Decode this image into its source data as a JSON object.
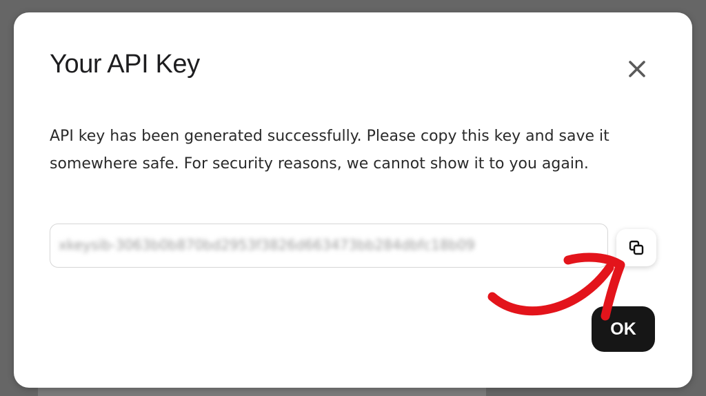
{
  "dialog": {
    "title": "Your API Key",
    "message": "API key has been generated successfully. Please copy this key and save it somewhere safe. For security reasons, we cannot show it to you again.",
    "api_key_masked": "xkeysib-3063b0b870bd2953f3826d663473bb284dbfc18b09",
    "ok_label": "OK"
  },
  "icons": {
    "close": "close-icon",
    "copy": "copy-icon"
  },
  "colors": {
    "ok_background": "#161616",
    "annotation": "#e3141b"
  }
}
